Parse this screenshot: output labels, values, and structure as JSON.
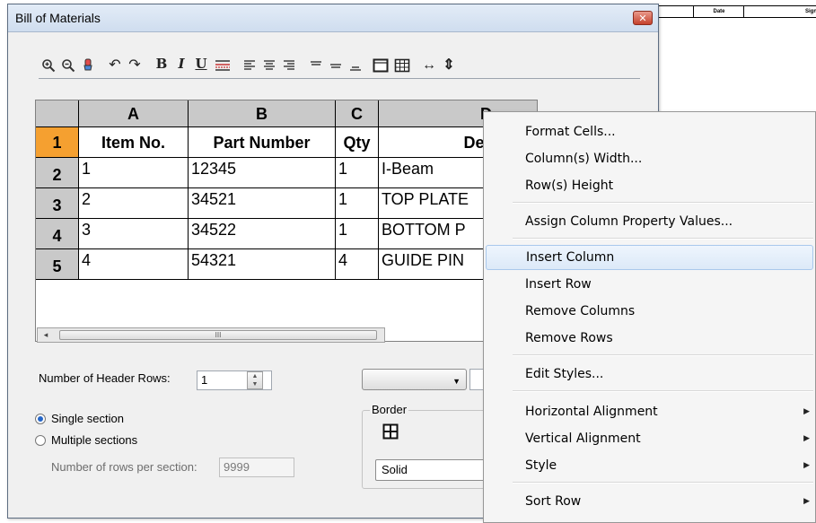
{
  "background_sheet": {
    "col1": "Date",
    "col2": "Sign"
  },
  "dialog": {
    "title": "Bill of Materials",
    "close_glyph": "✕"
  },
  "toolbar_icons": [
    "zoom-in-icon",
    "zoom-out-icon",
    "pan-icon",
    "undo-icon",
    "redo-icon",
    "bold-icon",
    "italic-icon",
    "underline-icon",
    "strikethrough-icon",
    "align-left-icon",
    "align-center-icon",
    "align-right-icon",
    "align-top-icon",
    "align-middle-icon",
    "align-bottom-icon",
    "cell-border-icon",
    "grid-icon",
    "fit-width-icon",
    "fit-height-icon"
  ],
  "toolbar_glyphs": {
    "undo": "↶",
    "redo": "↷",
    "bold": "B",
    "italic": "I",
    "underline": "U",
    "fit_width": "↔",
    "fit_height": "⇕"
  },
  "grid": {
    "column_headers": [
      "A",
      "B",
      "C",
      "D"
    ],
    "row_headers": [
      "1",
      "2",
      "3",
      "4",
      "5"
    ],
    "header_row": [
      "Item No.",
      "Part Number",
      "Qty",
      "Descr"
    ],
    "rows": [
      [
        "1",
        "12345",
        "1",
        "I-Beam"
      ],
      [
        "2",
        "34521",
        "1",
        "TOP PLATE"
      ],
      [
        "3",
        "34522",
        "1",
        "BOTTOM P"
      ],
      [
        "4",
        "54321",
        "4",
        "GUIDE PIN"
      ]
    ],
    "scroll_thumb_glyph": "III",
    "scroll_left": "◂"
  },
  "options": {
    "header_rows_label": "Number of Header Rows:",
    "header_rows_value": "1",
    "single_section": "Single section",
    "multiple_sections": "Multiple sections",
    "rows_per_section_label": "Number of rows per section:",
    "rows_per_section_value": "9999",
    "border_label": "Border",
    "border_style": "Solid",
    "combo_caret": "▼",
    "spin_up": "▲",
    "spin_down": "▼"
  },
  "context_menu": {
    "items": [
      {
        "label": "Format Cells..."
      },
      {
        "label": "Column(s) Width..."
      },
      {
        "label": "Row(s) Height"
      },
      {
        "label": "Assign Column Property Values..."
      },
      {
        "label": "Insert Column",
        "highlighted": true
      },
      {
        "label": "Insert Row"
      },
      {
        "label": "Remove Columns"
      },
      {
        "label": "Remove Rows"
      },
      {
        "label": "Edit Styles..."
      },
      {
        "label": "Horizontal Alignment",
        "submenu": true
      },
      {
        "label": "Vertical Alignment",
        "submenu": true
      },
      {
        "label": "Style",
        "submenu": true
      },
      {
        "label": "Sort Row",
        "submenu": true
      }
    ],
    "submenu_arrow": "▶"
  },
  "colors": {
    "row_highlight": "#f5a030",
    "header_bg": "#c9c9c9",
    "menu_hover": "#dce9f8"
  }
}
